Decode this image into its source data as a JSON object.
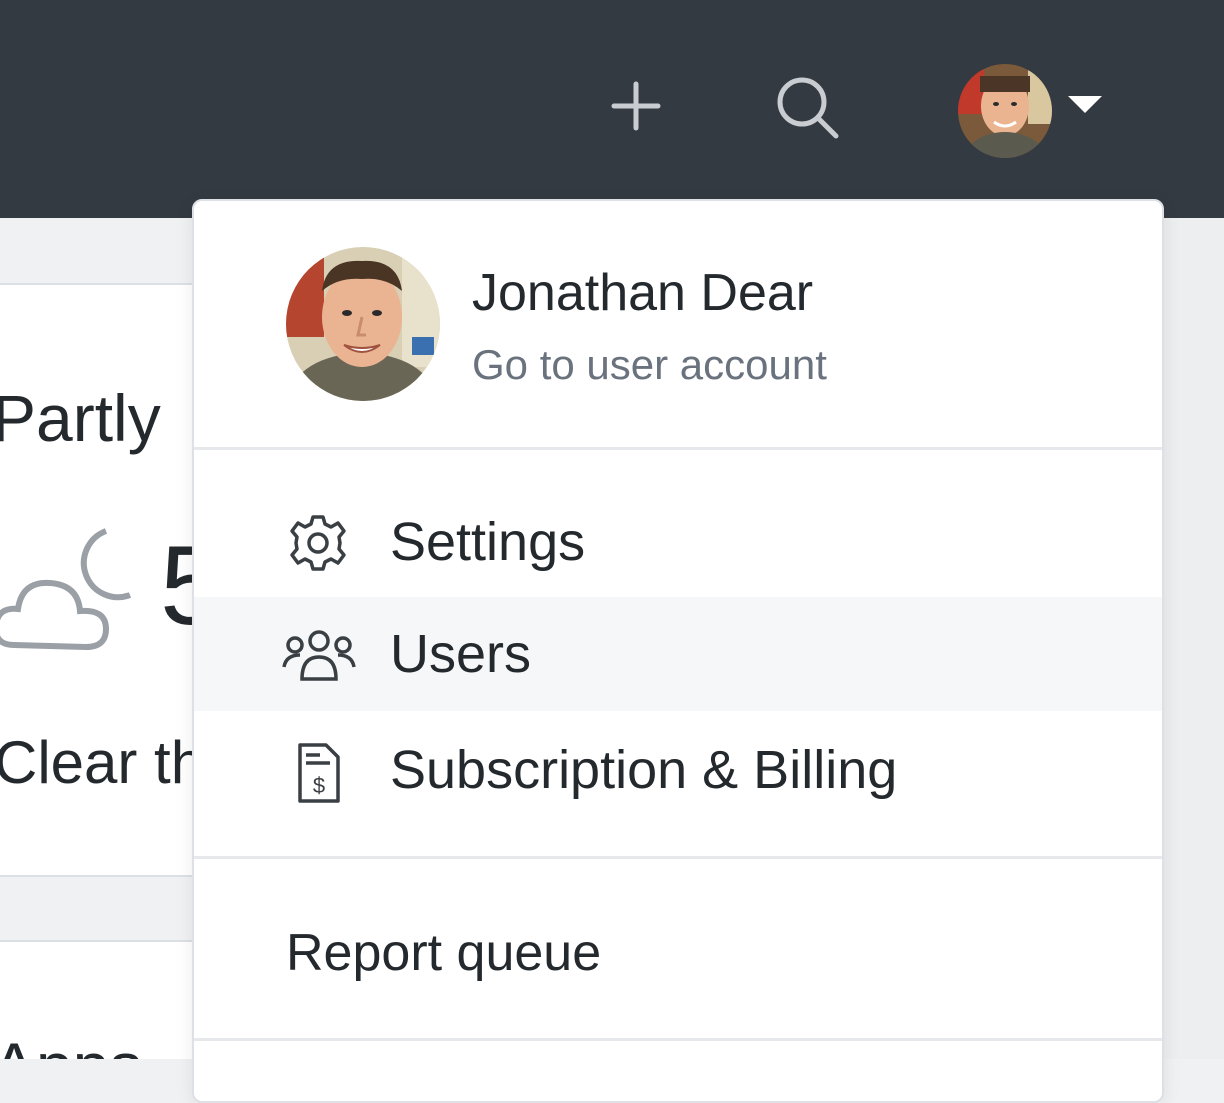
{
  "header": {
    "add_icon": "plus-icon",
    "search_icon": "search-icon",
    "avatar_icon": "user-avatar",
    "caret_icon": "caret-down-icon",
    "bg_color": "#343a41"
  },
  "background": {
    "weather_title": "Partly",
    "weather_temp": "5",
    "weather_desc": "Clear thr",
    "apps_title": "Apps"
  },
  "dropdown": {
    "user_name": "Jonathan Dear",
    "user_link": "Go to user account",
    "items": [
      {
        "label": "Settings",
        "icon": "gear-icon"
      },
      {
        "label": "Users",
        "icon": "users-icon"
      },
      {
        "label": "Subscription & Billing",
        "icon": "invoice-dollar-icon"
      }
    ],
    "report_label": "Report queue"
  }
}
